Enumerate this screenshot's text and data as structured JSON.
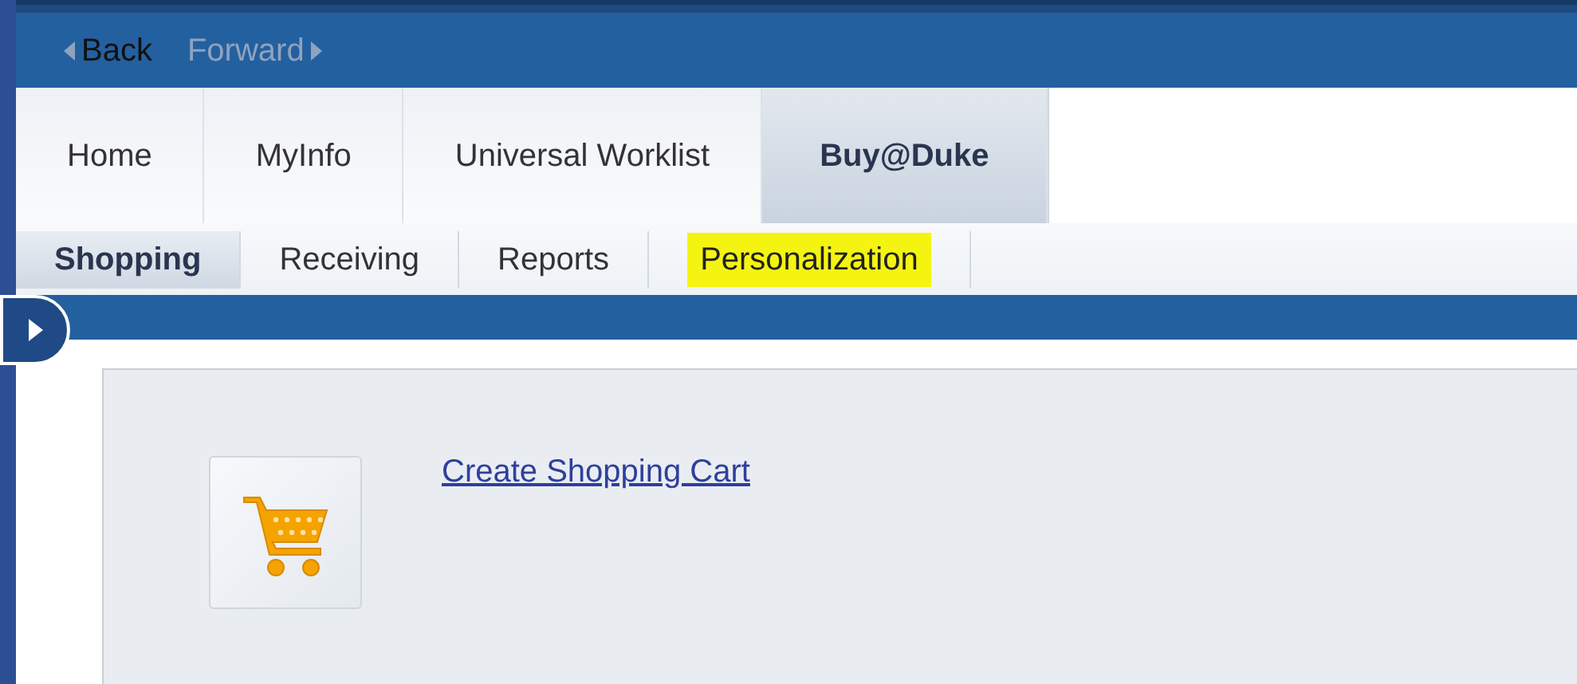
{
  "history": [
    {
      "label": "Back",
      "kind": "back",
      "disabled": false
    },
    {
      "label": "Forward",
      "kind": "forward",
      "disabled": true
    }
  ],
  "tabs": [
    {
      "label": "Home",
      "selected": false
    },
    {
      "label": "MyInfo",
      "selected": false
    },
    {
      "label": "Universal Worklist",
      "selected": false
    },
    {
      "label": "Buy@Duke",
      "selected": true
    }
  ],
  "subtabs": [
    {
      "label": "Shopping",
      "selected": true,
      "highlighted": false
    },
    {
      "label": "Receiving",
      "selected": false,
      "highlighted": false
    },
    {
      "label": "Reports",
      "selected": false,
      "highlighted": false
    },
    {
      "label": "Personalization",
      "selected": false,
      "highlighted": true
    }
  ],
  "content": {
    "links": [
      {
        "label": "Create Shopping Cart"
      }
    ]
  }
}
